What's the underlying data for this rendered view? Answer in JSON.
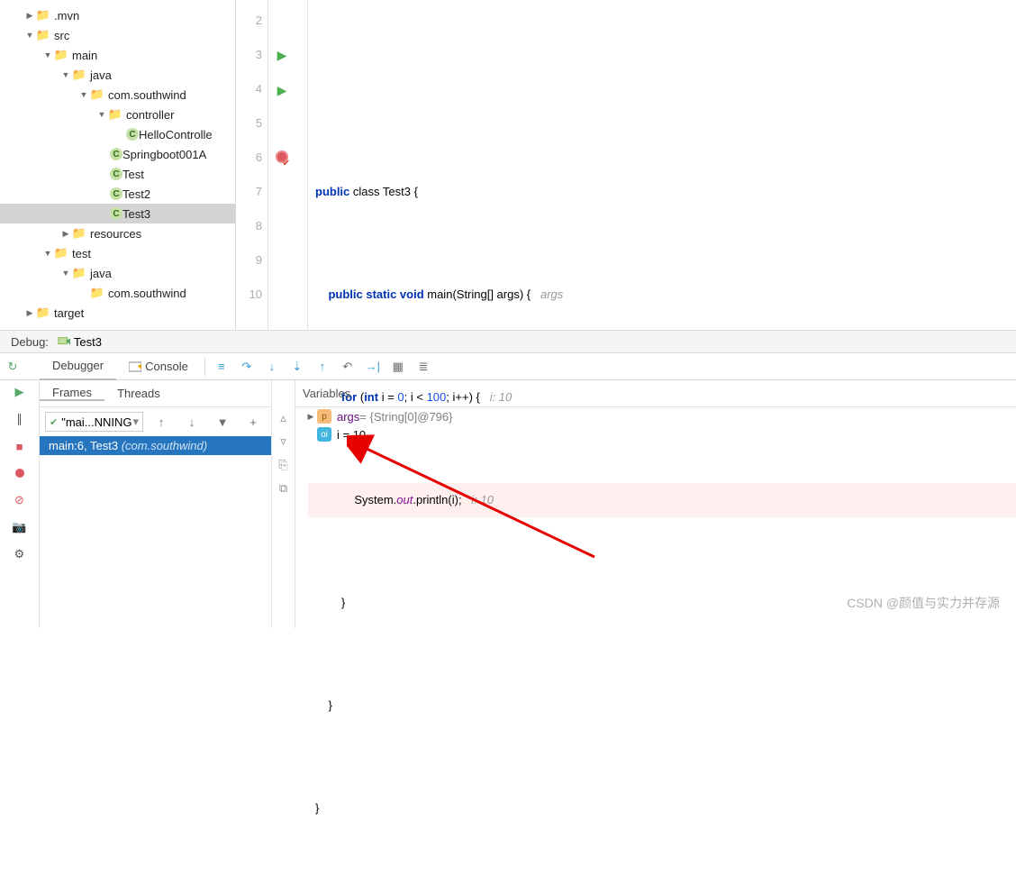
{
  "tree": {
    "mvn": ".mvn",
    "src": "src",
    "main": "main",
    "java": "java",
    "pkg": "com.southwind",
    "controller": "controller",
    "hello": "HelloControlle",
    "app": "Springboot001A",
    "test": "Test",
    "test2": "Test2",
    "test3": "Test3",
    "resources": "resources",
    "test_folder": "test",
    "test_java": "java",
    "test_pkg": "com.southwind",
    "target": "target"
  },
  "gutter": [
    "2",
    "3",
    "4",
    "5",
    "6",
    "7",
    "8",
    "9",
    "10"
  ],
  "code": {
    "l3a": "public",
    "l3b": " class ",
    "l3c": "Test3 {",
    "l4a": "    public static void ",
    "l4b": "main",
    "l4c": "(String[] args) {",
    "l4i": "   args",
    "l5a": "        for ",
    "l5b": "(",
    "l5c": "int",
    "l5d": " i = ",
    "l5e": "0",
    "l5f": "; i < ",
    "l5g": "100",
    "l5h": "; i++) {",
    "l5i": "   i: 10",
    "l6a": "            System.",
    "l6b": "out",
    "l6c": ".println(i);",
    "l6i": "   i: 10",
    "l7": "        }",
    "l8": "    }",
    "l9": "}"
  },
  "debug": {
    "label": "Debug:",
    "config": "Test3",
    "tab_debugger": "Debugger",
    "tab_console": "Console",
    "sub_frames": "Frames",
    "sub_threads": "Threads",
    "thread": "\"mai...NNING",
    "frame_loc": "main:6, Test3 ",
    "frame_pkg": "(com.southwind)",
    "vars_header": "Variables",
    "var1_name": "args",
    "var1_val": " = {String[0]@796}",
    "var2_text": "i = 10"
  },
  "watermark": "CSDN @颜值与实力并存源"
}
